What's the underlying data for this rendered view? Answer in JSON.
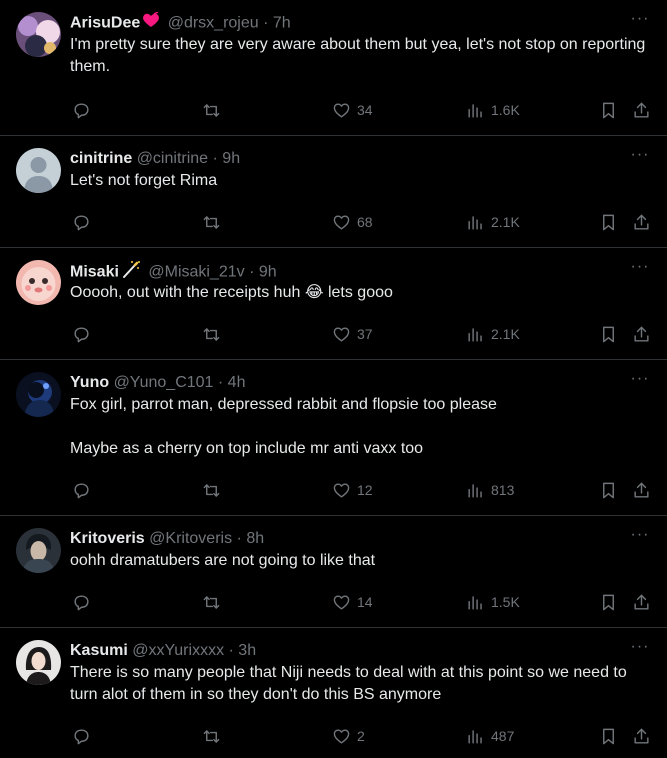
{
  "tweets": [
    {
      "name": "ArisuDee",
      "badge": "heart",
      "handle": "@drsx_rojeu",
      "dot": "·",
      "time": "7h",
      "text": "I'm pretty sure they are very aware about them but yea, let's not stop on reporting them.",
      "reply_count": "",
      "retweet_count": "",
      "like_count": "34",
      "view_count": "1.6K"
    },
    {
      "name": "cinitrine",
      "badge": "",
      "handle": "@cinitrine",
      "dot": "·",
      "time": "9h",
      "text": "Let's not forget Rima",
      "reply_count": "",
      "retweet_count": "",
      "like_count": "68",
      "view_count": "2.1K"
    },
    {
      "name": "Misaki",
      "badge": "wand",
      "handle": "@Misaki_21v",
      "dot": "·",
      "time": "9h",
      "text": "Ooooh, out with the receipts huh 😂 lets gooo",
      "reply_count": "",
      "retweet_count": "",
      "like_count": "37",
      "view_count": "2.1K"
    },
    {
      "name": "Yuno",
      "badge": "",
      "handle": "@Yuno_C101",
      "dot": "·",
      "time": "4h",
      "text": "Fox girl, parrot man, depressed rabbit and flopsie too please\n\nMaybe as a cherry on top include mr anti vaxx too",
      "reply_count": "",
      "retweet_count": "",
      "like_count": "12",
      "view_count": "813"
    },
    {
      "name": "Kritoveris",
      "badge": "",
      "handle": "@Kritoveris",
      "dot": "·",
      "time": "8h",
      "text": "oohh dramatubers are not going to like that",
      "reply_count": "",
      "retweet_count": "",
      "like_count": "14",
      "view_count": "1.5K"
    },
    {
      "name": "Kasumi",
      "badge": "",
      "handle": "@xxYurixxxx",
      "dot": "·",
      "time": "3h",
      "text": "There is so many people that Niji needs to deal with at this point so we need to turn alot of them in so they don't do this BS anymore",
      "reply_count": "",
      "retweet_count": "",
      "like_count": "2",
      "view_count": "487"
    }
  ],
  "more_glyph": "···",
  "colors": {
    "background": "#000000",
    "text": "#e7e9ea",
    "secondary": "#71767b",
    "divider": "#2f3336",
    "badge_heart": "#f91880"
  },
  "icons": [
    "reply-icon",
    "retweet-icon",
    "like-icon",
    "views-icon",
    "bookmark-icon",
    "share-icon",
    "more-icon"
  ]
}
